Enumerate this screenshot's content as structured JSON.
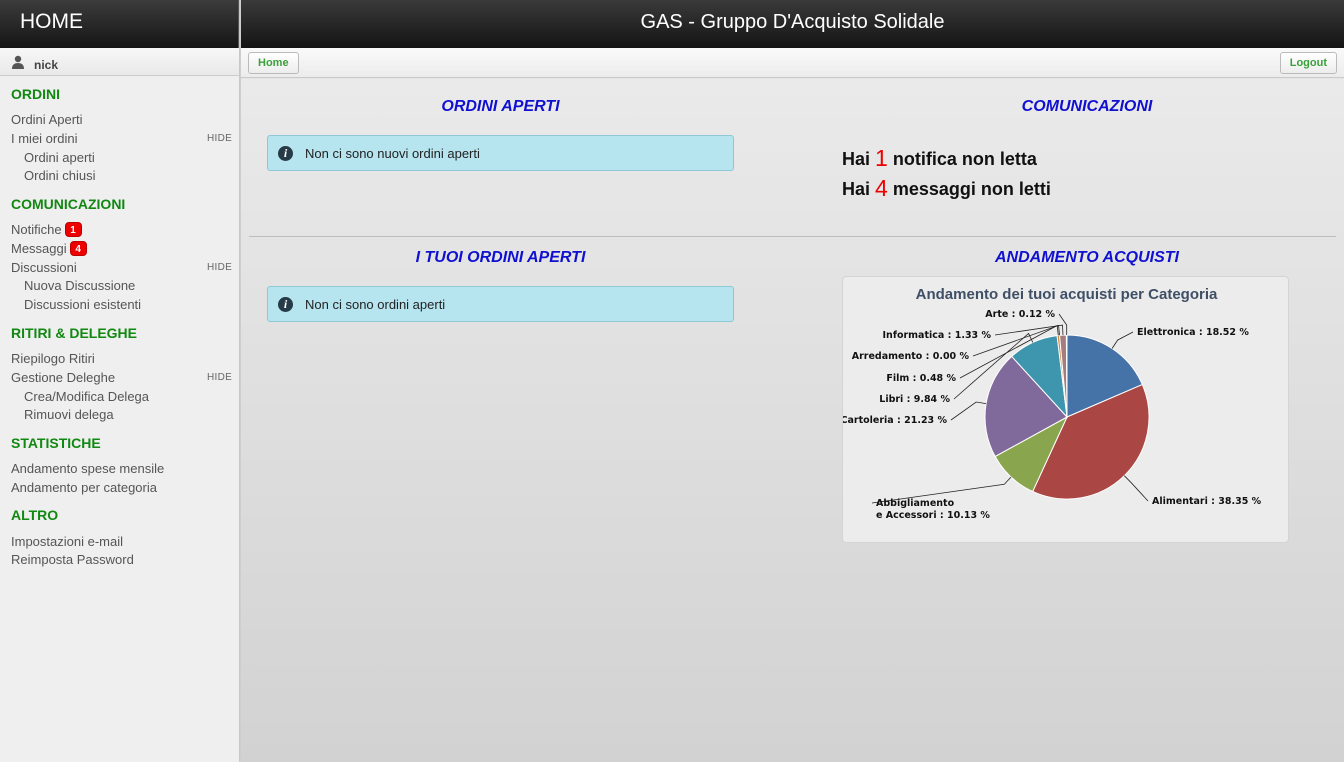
{
  "app": {
    "home_title": "HOME",
    "title": "GAS - Gruppo D'Acquisto Solidale"
  },
  "user": {
    "name": "nick"
  },
  "nav": {
    "home_label": "Home",
    "logout_label": "Logout"
  },
  "sidebar": {
    "hide_label": "HIDE",
    "ordini": {
      "title": "ORDINI",
      "ordini_aperti": "Ordini Aperti",
      "miei_ordini": "I miei ordini",
      "sub_aperti": "Ordini aperti",
      "sub_chiusi": "Ordini chiusi"
    },
    "comunicazioni": {
      "title": "COMUNICAZIONI",
      "notifiche": "Notifiche",
      "notifiche_count": "1",
      "messaggi": "Messaggi",
      "messaggi_count": "4",
      "discussioni": "Discussioni",
      "nuova_discussione": "Nuova Discussione",
      "discussioni_esistenti": "Discussioni esistenti"
    },
    "ritiri": {
      "title": "RITIRI & DELEGHE",
      "riepilogo": "Riepilogo Ritiri",
      "gestione_deleghe": "Gestione Deleghe",
      "crea_modifica": "Crea/Modifica Delega",
      "rimuovi": "Rimuovi delega"
    },
    "statistiche": {
      "title": "STATISTICHE",
      "spese_mensile": "Andamento spese mensile",
      "per_categoria": "Andamento per categoria"
    },
    "altro": {
      "title": "ALTRO",
      "impostazioni_email": "Impostazioni e-mail",
      "reimposta_password": "Reimposta Password"
    }
  },
  "main": {
    "ordini_aperti": {
      "title": "ORDINI APERTI",
      "message": "Non ci sono nuovi ordini aperti"
    },
    "comunicazioni": {
      "title": "COMUNICAZIONI",
      "line1_prefix": "Hai",
      "line1_count": "1",
      "line1_suffix": "notifica non letta",
      "line2_prefix": "Hai",
      "line2_count": "4",
      "line2_suffix": "messaggi non letti"
    },
    "tuoi_ordini": {
      "title": "I TUOI ORDINI APERTI",
      "message": "Non ci sono ordini aperti"
    },
    "andamento": {
      "title": "ANDAMENTO ACQUISTI"
    }
  },
  "chart_data": {
    "type": "pie",
    "title": "Andamento dei tuoi acquisti per Categoria",
    "slices": [
      {
        "label": "Elettronica",
        "value": 18.52,
        "color": "#4572a7"
      },
      {
        "label": "Alimentari",
        "value": 38.35,
        "color": "#aa4643"
      },
      {
        "label": "Abbigliamento e Accessori",
        "value": 10.13,
        "color": "#89a54e"
      },
      {
        "label": "Cartoleria",
        "value": 21.23,
        "color": "#80699b"
      },
      {
        "label": "Libri",
        "value": 9.84,
        "color": "#3d96ae"
      },
      {
        "label": "Film",
        "value": 0.48,
        "color": "#db843d"
      },
      {
        "label": "Arredamento",
        "value": 0.0,
        "color": "#92a8cd"
      },
      {
        "label": "Informatica",
        "value": 1.33,
        "color": "#a47d7c"
      },
      {
        "label": "Arte",
        "value": 0.12,
        "color": "#b5ca92"
      }
    ],
    "label_texts": [
      "Elettronica : 18.52 %",
      "Alimentari : 38.35 %",
      "Abbigliamento",
      "e Accessori : 10.13 %",
      "Cartoleria : 21.23 %",
      "Libri : 9.84 %",
      "Film : 0.48 %",
      "Arredamento : 0.00 %",
      "Informatica : 1.33 %",
      "Arte : 0.12 %"
    ]
  }
}
